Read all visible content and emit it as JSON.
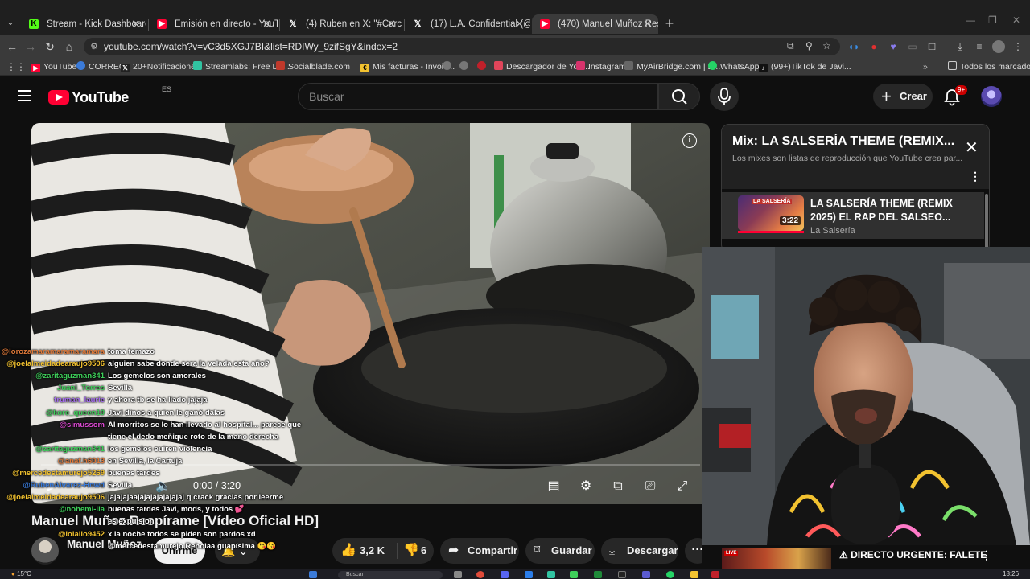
{
  "browser": {
    "tabs": [
      {
        "label": "Stream - Kick Dashboard",
        "favicon": "kick-icon",
        "color": "#53fc18"
      },
      {
        "label": "Emisión en directo - YouTube S",
        "favicon": "youtube-icon",
        "color": "#ff0033"
      },
      {
        "label": "(4) Ruben en X: \"#CarcelGemel",
        "favicon": "x-icon",
        "color": "#ffffff"
      },
      {
        "label": "(17) L.A. Confidential (@confid",
        "favicon": "x-icon",
        "color": "#ffffff"
      },
      {
        "label": "(470) Manuel Muñoz Respíram",
        "favicon": "youtube-icon",
        "color": "#ff0033"
      }
    ],
    "active_tab": 4,
    "url": "youtube.com/watch?v=vC3d5XGJ7BI&list=RDIWy_9zifSgY&index=2",
    "bookmarks": [
      {
        "label": "YouTube",
        "color": "#ff0033"
      },
      {
        "label": "CORREO",
        "color": "#3b7bd9"
      },
      {
        "label": "20+Notificaciones",
        "color": "#222222"
      },
      {
        "label": "Streamlabs: Free Liv...",
        "color": "#31c3a2"
      },
      {
        "label": "Socialblade.com",
        "color": "#c0392b"
      },
      {
        "label": "Mis facturas - Invoic...",
        "color": "#f2c230"
      },
      {
        "label": "Descargador de You...",
        "color": "#e0455a"
      },
      {
        "label": "Instagram",
        "color": "#d6336c"
      },
      {
        "label": "MyAirBridge.com | E...",
        "color": "#666666"
      },
      {
        "label": "WhatsApp",
        "color": "#25d366"
      },
      {
        "label": "(99+)TikTok de Javi...",
        "color": "#111111"
      }
    ],
    "all_bookmarks": "Todos los marcadores"
  },
  "youtube": {
    "logo_text": "YouTube",
    "country_code": "ES",
    "search_placeholder": "Buscar",
    "create_label": "Crear",
    "notifications_badge": "9+"
  },
  "player": {
    "time": "0:00 / 3:20"
  },
  "video": {
    "title": "Manuel Muñoz Respírame [Vídeo Oficial HD]",
    "channel": "Manuel Muñoz",
    "join_label": "Unirme",
    "likes": "3,2 K",
    "dislikes": "6",
    "share_label": "Compartir",
    "save_label": "Guardar",
    "download_label": "Descargar"
  },
  "mix_panel": {
    "title": "Mix: LA SALSERÍA THEME (REMIX...",
    "subtitle": "Los mixes son listas de reproducción que YouTube crea par...",
    "item": {
      "title": "LA SALSERÍA THEME (REMIX 2025) EL RAP DEL SALSEO...",
      "channel": "La Salsería",
      "duration": "3:22",
      "thumb_label": "LA SALSERÍA"
    }
  },
  "chat": [
    {
      "user": "@lorozamaramaramaramara",
      "msg": "toma temazo",
      "color": "#e07a3a"
    },
    {
      "user": "@joelalmeidadearaujo9506",
      "msg": "alguien sabe donde sera la velada esta año?",
      "color": "#f2c230"
    },
    {
      "user": "@zaritaguzman341",
      "msg": "Los gemelos son amorales",
      "color": "#3ecf5a"
    },
    {
      "user": "Juani_Torres",
      "msg": "Sevilla",
      "color": "#3ecf5a"
    },
    {
      "user": "truman_laurie",
      "msg": "y ahora tb se ha liado jajaja",
      "color": "#a56cf0"
    },
    {
      "user": "@kore_queen10",
      "msg": "Javi dinos a quien le ganó dalas",
      "color": "#3ecf5a"
    },
    {
      "user": "@simussom",
      "msg": "Al morritos se lo han llevado al hospital... parece que",
      "color": "#e04bd6"
    },
    {
      "user": "",
      "msg": "tiene el dedo meñique roto de la mano derecha",
      "color": "#ffffff"
    },
    {
      "user": "@zaritaguzman341",
      "msg": "los gemelos euiren violencia",
      "color": "#3ecf5a"
    },
    {
      "user": "@anaf.h6013",
      "msg": "en Sevilla, la Cartuja",
      "color": "#e07a3a"
    },
    {
      "user": "@mercedestamurejo5269",
      "msg": "buenas tardes",
      "color": "#f2c230"
    },
    {
      "user": "@RubenAlvarez-Hnwd",
      "msg": "Sevilla",
      "color": "#3b7bd9"
    },
    {
      "user": "@joelalmeidadearaujo9506",
      "msg": "jajajajaajajajajajajajaj q crack gracias por leerme",
      "color": "#f2c230"
    },
    {
      "user": "@nohemi-lia",
      "msg": "buenas tardes Javi, mods, y todos 💕",
      "color": "#3ecf5a"
    },
    {
      "user": "",
      "msg": "es expulsion",
      "color": "#ffffff"
    },
    {
      "user": "@lolallo9452",
      "msg": "x la noche todos se piden son pardos xd",
      "color": "#f2c230"
    },
    {
      "user": "",
      "msg": "@mercedestamurejo Reholaa guapísima 😘😘",
      "color": "#ffffff"
    }
  ],
  "bottom_strip": {
    "live_label": "LIVE",
    "title": "⚠ DIRECTO URGENTE: FALETE"
  },
  "taskbar": {
    "weather": "15°C",
    "search_placeholder": "Buscar",
    "clock": "18:26"
  }
}
